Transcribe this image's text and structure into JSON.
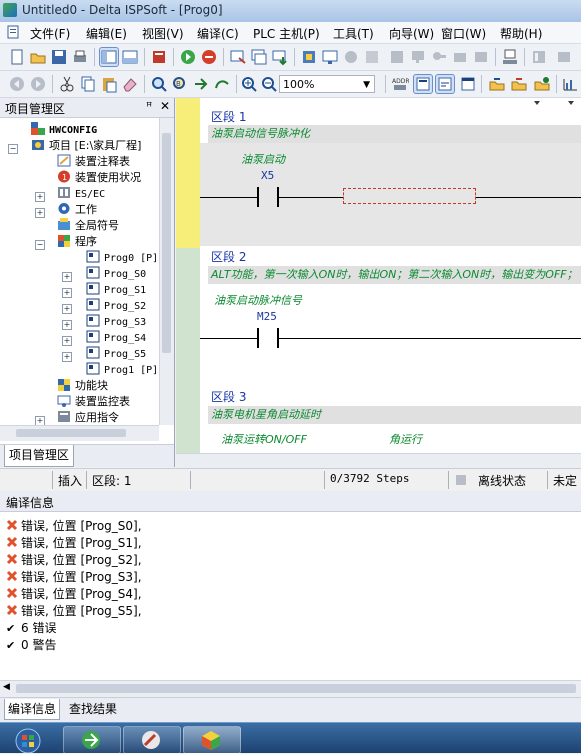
{
  "window": {
    "title": "Untitled0 - Delta ISPSoft - [Prog0]"
  },
  "menu": [
    "文件(F)",
    "编辑(E)",
    "视图(V)",
    "编译(C)",
    "PLC 主机(P)",
    "工具(T)",
    "向导(W)",
    "窗口(W)",
    "帮助(H)"
  ],
  "toolbar": {
    "zoom": "100%"
  },
  "project_panel": {
    "title": "项目管理区",
    "pin_icon": "pin-icon",
    "close_icon": "close-icon",
    "tab_label": "项目管理区",
    "tree": [
      {
        "label": "HWCONFIG",
        "icon": "hwconfig-icon"
      },
      {
        "label": "项目 [E:\\家具厂程]",
        "icon": "project-icon"
      },
      {
        "label": "装置注释表",
        "icon": "comment-table-icon"
      },
      {
        "label": "装置使用状况",
        "icon": "device-usage-icon"
      },
      {
        "label": "ES/EC",
        "icon": "esec-icon"
      },
      {
        "label": "工作",
        "icon": "task-icon"
      },
      {
        "label": "全局符号",
        "icon": "global-symbol-icon"
      },
      {
        "label": "程序",
        "icon": "program-folder-icon"
      },
      {
        "label": "Prog0 [P]",
        "icon": "program-icon"
      },
      {
        "label": "Prog_S0",
        "icon": "program-icon"
      },
      {
        "label": "Prog_S1",
        "icon": "program-icon"
      },
      {
        "label": "Prog_S2",
        "icon": "program-icon"
      },
      {
        "label": "Prog_S3",
        "icon": "program-icon"
      },
      {
        "label": "Prog_S4",
        "icon": "program-icon"
      },
      {
        "label": "Prog_S5",
        "icon": "program-icon"
      },
      {
        "label": "Prog1 [P]",
        "icon": "program-icon"
      },
      {
        "label": "功能块",
        "icon": "function-block-icon"
      },
      {
        "label": "装置监控表",
        "icon": "monitor-table-icon"
      },
      {
        "label": "应用指令",
        "icon": "instruction-icon"
      }
    ]
  },
  "ladder": {
    "sections": [
      {
        "title": "区段 1",
        "comment": "油泵启动信号脉冲化",
        "contact_comment": "油泵启动",
        "contact": "X5"
      },
      {
        "title": "区段 2",
        "comment": "ALT功能，第一次输入ON时，输出ON；第二次输入ON时，输出变为OFF；",
        "contact_comment": "油泵启动脉冲信号",
        "contact": "M25"
      },
      {
        "title": "区段 3",
        "comment": "油泵电机星角启动延时",
        "contact_comment": "油泵运转ON/OFF",
        "contact_comment_2": "角运行"
      }
    ]
  },
  "statusbar": {
    "mode": "插入",
    "section": "区段: 1",
    "steps": "0/3792 Steps",
    "state": "离线状态",
    "extra": "未定"
  },
  "compile_info": {
    "title": "编译信息",
    "messages": [
      {
        "type": "error",
        "text": "错误, 位置 [Prog_S0],"
      },
      {
        "type": "error",
        "text": "错误, 位置 [Prog_S1],"
      },
      {
        "type": "error",
        "text": "错误, 位置 [Prog_S2],"
      },
      {
        "type": "error",
        "text": "错误, 位置 [Prog_S3],"
      },
      {
        "type": "error",
        "text": "错误, 位置 [Prog_S4],"
      },
      {
        "type": "error",
        "text": "错误, 位置 [Prog_S5],"
      },
      {
        "type": "ok",
        "text": "6 错误"
      },
      {
        "type": "ok",
        "text": "0 警告"
      }
    ],
    "tabs": [
      "编译信息",
      "查找结果"
    ]
  },
  "colors": {
    "error": "#e0522b",
    "comment_text": "#0a8a2f",
    "section_title": "#1a36a8",
    "selection": "#c0392b"
  }
}
